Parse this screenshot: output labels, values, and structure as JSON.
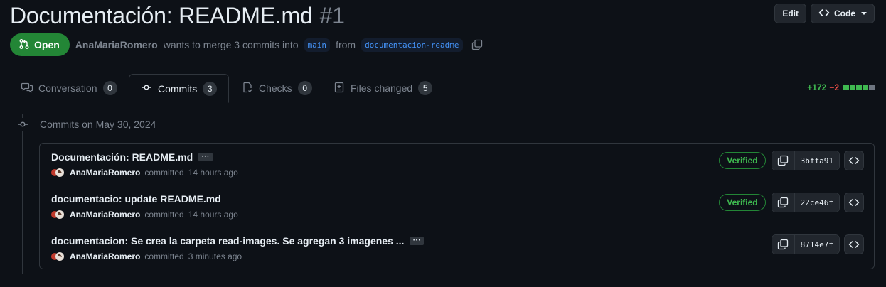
{
  "pr": {
    "title": "Documentación: README.md",
    "number": "#1",
    "state_label": "Open",
    "author": "AnaMariaRomero",
    "merge_text": "wants to merge 3 commits into",
    "base_branch": "main",
    "from_text": "from",
    "head_branch": "documentacion-readme"
  },
  "header_actions": {
    "edit_label": "Edit",
    "code_label": "Code"
  },
  "tabs": [
    {
      "label": "Conversation",
      "count": "0",
      "icon": "comment-discussion-icon"
    },
    {
      "label": "Commits",
      "count": "3",
      "icon": "git-commit-icon"
    },
    {
      "label": "Checks",
      "count": "0",
      "icon": "checklist-icon"
    },
    {
      "label": "Files changed",
      "count": "5",
      "icon": "file-diff-icon"
    }
  ],
  "diffstat": {
    "additions": "+172",
    "deletions": "−2",
    "colors": [
      "#3fb950",
      "#3fb950",
      "#3fb950",
      "#3fb950",
      "#6e7681"
    ]
  },
  "commit_group": {
    "heading": "Commits on May 30, 2024"
  },
  "commits": [
    {
      "message": "Documentación: README.md",
      "author": "AnaMariaRomero",
      "action": "committed",
      "time": "14 hours ago",
      "verified": "Verified",
      "sha": "3bffa91"
    },
    {
      "message": "documentacio: update README.md",
      "author": "AnaMariaRomero",
      "action": "committed",
      "time": "14 hours ago",
      "verified": "Verified",
      "sha": "22ce46f"
    },
    {
      "message": "documentacion: Se crea la carpeta read-images. Se agregan 3 imagenes ...",
      "author": "AnaMariaRomero",
      "action": "committed",
      "time": "3 minutes ago",
      "verified": "",
      "sha": "8714e7f"
    }
  ],
  "colors": {
    "background": "#0d1117",
    "accent_green": "#238636",
    "link_blue": "#4493f8",
    "muted": "#7d8590"
  }
}
